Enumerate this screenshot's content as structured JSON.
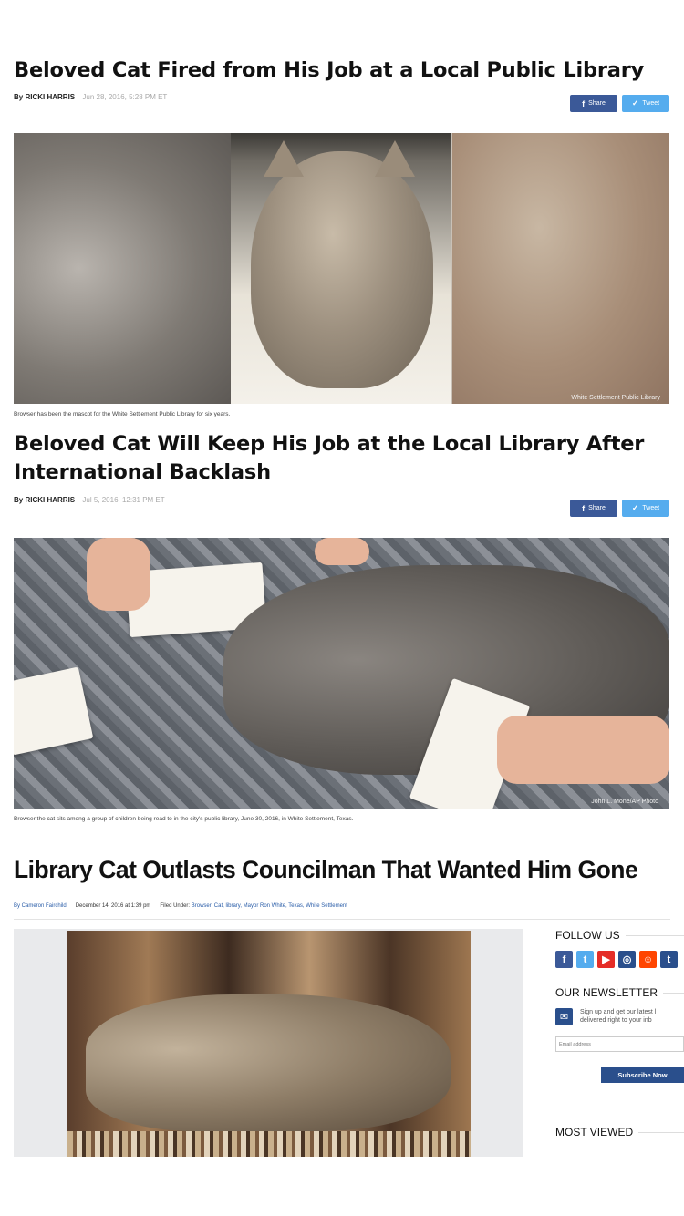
{
  "articles": [
    {
      "headline": "Beloved Cat Fired from His Job at a Local Public Library",
      "author_prefix": "By",
      "author": "RICKI HARRIS",
      "date": "Jun 28, 2016, 5:28 PM ET",
      "share_label": "Share",
      "tweet_label": "Tweet",
      "caption": "Browser has been the mascot for the White Settlement Public Library for six years.",
      "credit": "White Settlement Public Library"
    },
    {
      "headline": "Beloved Cat Will Keep His Job at the Local Library After International Backlash",
      "author_prefix": "By",
      "author": "RICKI HARRIS",
      "date": "Jul 5, 2016, 12:31 PM ET",
      "share_label": "Share",
      "tweet_label": "Tweet",
      "caption": "Browser the cat sits among a group of children being read to in the city's public library, June 30, 2016, in White Settlement, Texas.",
      "credit": "John L. Mone/AP Photo"
    },
    {
      "headline": "Library Cat Outlasts Councilman That Wanted Him Gone",
      "byline": "By Cameron Fairchild",
      "date": "December 14, 2016 at 1:39 pm",
      "filed_label": "Filed Under:",
      "tags": "Browser, Cat, library, Mayor Ron White, Texas, White Settlement"
    }
  ],
  "sidebar": {
    "follow_title": "FOLLOW US",
    "newsletter_title": "OUR NEWSLETTER",
    "newsletter_text_1": "Sign up and get our latest l",
    "newsletter_text_2": "delivered right to your inb",
    "email_placeholder": "Email address",
    "subscribe_label": "Subscribe Now",
    "most_viewed_title": "MOST VIEWED",
    "social_icons": [
      "facebook-icon",
      "twitter-icon",
      "youtube-icon",
      "instagram-icon",
      "reddit-icon",
      "tumblr-icon"
    ]
  },
  "colors": {
    "facebook": "#3b5998",
    "twitter": "#55acee",
    "brand_blue": "#2a4f8c",
    "youtube": "#e52d27",
    "reddit": "#ff4500",
    "instagram": "#2a4f8c"
  }
}
